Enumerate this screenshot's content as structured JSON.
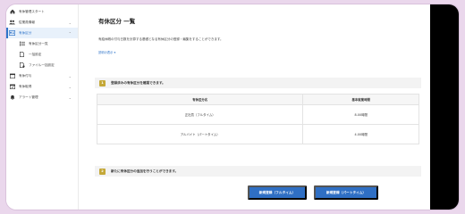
{
  "sidebar": {
    "items": [
      {
        "label": "有休管理スタート",
        "icon": "home-icon",
        "chevron": false
      },
      {
        "label": "従業員情報",
        "icon": "people-icon",
        "chevron": true
      },
      {
        "label": "有休区分",
        "icon": "id-card-icon",
        "chevron": true
      },
      {
        "label": "有休区分一覧",
        "icon": "list-icon",
        "chevron": false
      },
      {
        "label": "一括設定",
        "icon": "document-icon",
        "chevron": false
      },
      {
        "label": "ファイル一括設定",
        "icon": "file-settings-icon",
        "chevron": false
      },
      {
        "label": "有休付与",
        "icon": "calendar-icon",
        "chevron": true
      },
      {
        "label": "有休取得",
        "icon": "calendar-check-icon",
        "chevron": true
      },
      {
        "label": "アラート管理",
        "icon": "bell-icon",
        "chevron": true
      }
    ]
  },
  "main": {
    "title": "有休区分 一覧",
    "description": "有給休暇の付与日数を計算する基礎となる有休区分の登録・編集をすることができます。",
    "detail_link": "説明の表示",
    "section1": {
      "step": "1",
      "label": "登録済みの有休区分を確認できます。"
    },
    "table": {
      "headers": [
        "有休区分名",
        "基本就業時間"
      ],
      "rows": [
        [
          "正社員（フルタイム）",
          "8.00時間"
        ],
        [
          "アルバイト（パートタイム）",
          "4.00時間"
        ]
      ]
    },
    "section2": {
      "step": "2",
      "label": "新たに有休区分の追加を行うことができます。"
    },
    "buttons": {
      "register_fulltime": "新規登録（フルタイム）",
      "register_parttime": "新規登録（パートタイム）"
    }
  },
  "colors": {
    "accent": "#2f6fc4",
    "step_badge": "#c4a838",
    "active_bg": "#e8f1fb",
    "outer_bg": "#ead7ec"
  }
}
